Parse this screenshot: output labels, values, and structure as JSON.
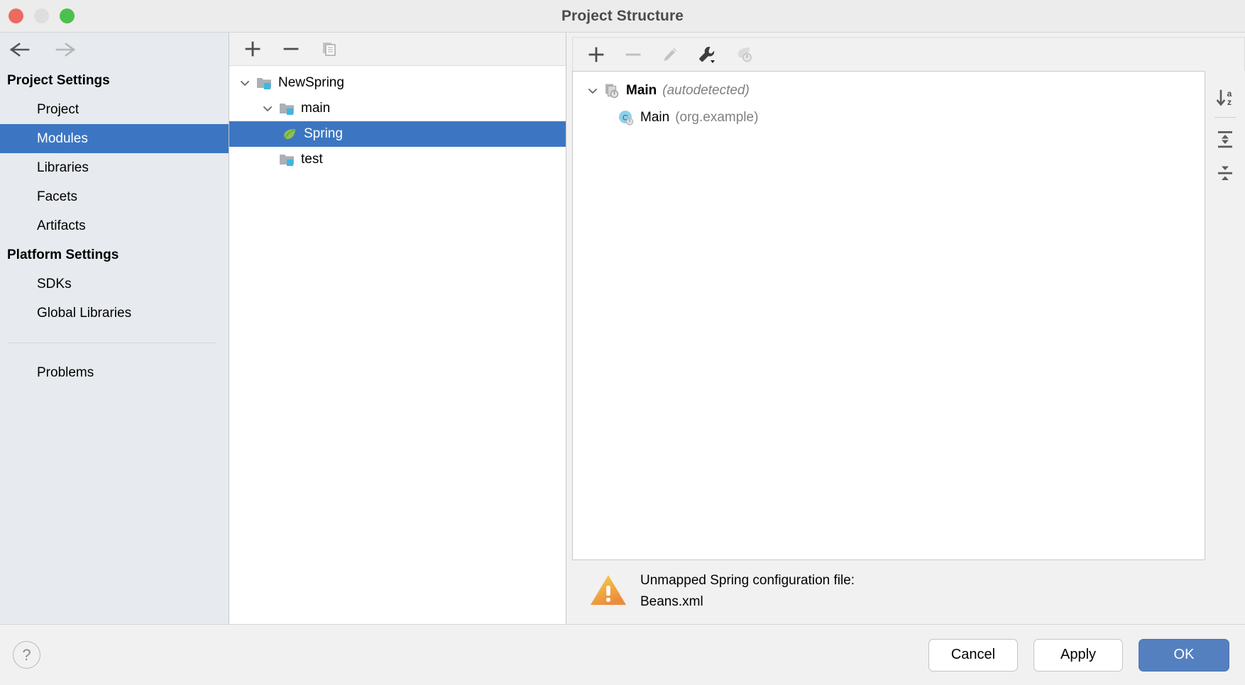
{
  "window": {
    "title": "Project Structure",
    "traffic_lights": [
      "close-red",
      "minimize-yellow",
      "zoom-green"
    ]
  },
  "sidebar": {
    "nav_back": "back-arrow",
    "nav_forward": "forward-arrow",
    "groups": [
      {
        "title": "Project Settings",
        "items": [
          {
            "label": "Project",
            "selected": false
          },
          {
            "label": "Modules",
            "selected": true
          },
          {
            "label": "Libraries",
            "selected": false
          },
          {
            "label": "Facets",
            "selected": false
          },
          {
            "label": "Artifacts",
            "selected": false
          }
        ]
      },
      {
        "title": "Platform Settings",
        "items": [
          {
            "label": "SDKs",
            "selected": false
          },
          {
            "label": "Global Libraries",
            "selected": false
          }
        ]
      }
    ],
    "problems": "Problems"
  },
  "modules_panel": {
    "toolbar": [
      {
        "name": "add-module-button",
        "glyph": "plus",
        "enabled": true
      },
      {
        "name": "remove-module-button",
        "glyph": "minus",
        "enabled": true
      },
      {
        "name": "copy-module-button",
        "glyph": "copy",
        "enabled": false
      }
    ],
    "tree": [
      {
        "label": "NewSpring",
        "icon": "module-folder-icon",
        "depth": 1,
        "expanded": true,
        "selected": false
      },
      {
        "label": "main",
        "icon": "source-folder-icon",
        "depth": 2,
        "expanded": true,
        "selected": false
      },
      {
        "label": "Spring",
        "icon": "spring-leaf-icon",
        "depth": 3,
        "expanded": null,
        "selected": true
      },
      {
        "label": "test",
        "icon": "test-folder-icon",
        "depth": 2,
        "expanded": null,
        "selected": false
      }
    ]
  },
  "facets_panel": {
    "toolbar": [
      {
        "name": "add-facet-button",
        "glyph": "plus",
        "enabled": true
      },
      {
        "name": "remove-facet-button",
        "glyph": "minus",
        "enabled": false
      },
      {
        "name": "edit-facet-button",
        "glyph": "pencil",
        "enabled": false
      },
      {
        "name": "configure-facet-button",
        "glyph": "wrench-dropdown",
        "enabled": true
      },
      {
        "name": "spring-config-button",
        "glyph": "spring-gear",
        "enabled": false
      }
    ],
    "tree": [
      {
        "name": "Main",
        "annotation": "(autodetected)",
        "icon": "spring-context-icon",
        "depth": 1,
        "expanded": true
      },
      {
        "name": "Main",
        "annotation": "(org.example)",
        "icon": "java-class-icon",
        "depth": 2,
        "expanded": null
      }
    ],
    "side_tools": [
      {
        "name": "sort-alphabetically-button",
        "glyph": "sort-az"
      },
      {
        "name": "expand-all-button",
        "glyph": "expand-all"
      },
      {
        "name": "collapse-all-button",
        "glyph": "collapse-all"
      }
    ]
  },
  "warning": {
    "icon": "warning-triangle-icon",
    "line1": "Unmapped Spring configuration file:",
    "line2": "Beans.xml"
  },
  "footer": {
    "help": "?",
    "cancel": "Cancel",
    "apply": "Apply",
    "ok": "OK"
  },
  "colors": {
    "selection_blue": "#3c76c2",
    "primary_button": "#5580c0",
    "sidebar_bg": "#e7eaee",
    "panel_bg": "#f1f1f1",
    "warning_orange": "#f0a63c"
  }
}
